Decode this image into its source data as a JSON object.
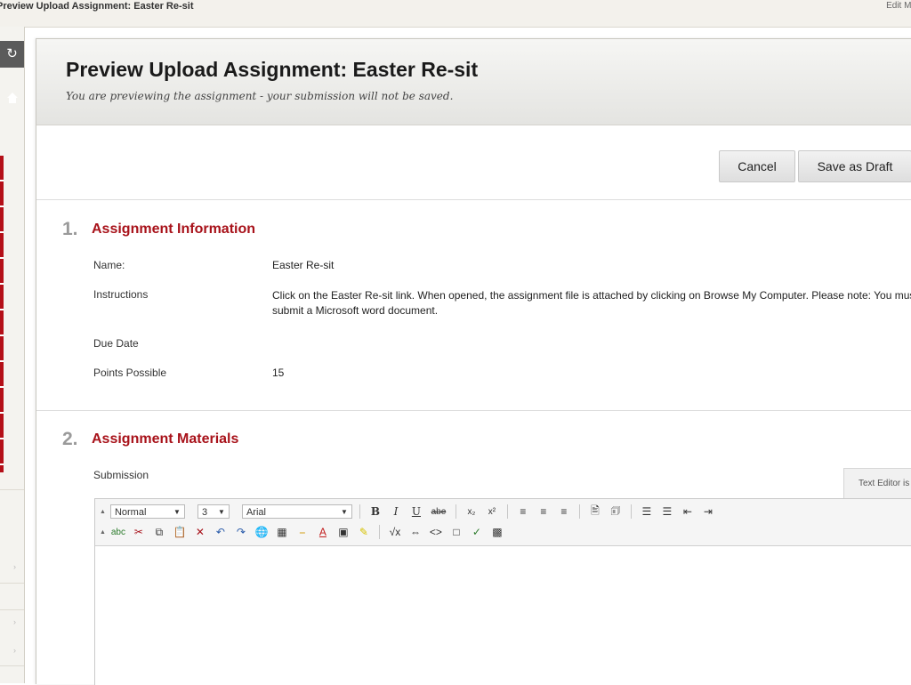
{
  "topbar": {
    "breadcrumb": "Preview Upload Assignment: Easter Re-sit",
    "edit_mode": "Edit Mo"
  },
  "header": {
    "title": "Preview Upload Assignment: Easter Re-sit",
    "subtitle": "You are previewing the assignment - your submission will not be saved."
  },
  "actions": {
    "cancel": "Cancel",
    "save_draft": "Save as Draft"
  },
  "section1": {
    "number": "1.",
    "title": "Assignment Information",
    "rows": [
      {
        "label": "Name:",
        "value": "Easter Re-sit"
      },
      {
        "label": "Instructions",
        "value": "Click on the Easter Re-sit link.  When opened,  the assignment file is attached by clicking on Browse My Computer.  Please note:  You must submit a Microsoft word document."
      },
      {
        "label": "Due Date",
        "value": ""
      },
      {
        "label": "Points Possible",
        "value": "15"
      }
    ]
  },
  "section2": {
    "number": "2.",
    "title": "Assignment Materials",
    "submission_label": "Submission",
    "text_editor_tab": "Text Editor is"
  },
  "editor": {
    "format_value": "Normal",
    "size_value": "3",
    "font_value": "Arial"
  },
  "colors": {
    "accent": "#a8121a",
    "leftnav_red": "#b40f18"
  }
}
